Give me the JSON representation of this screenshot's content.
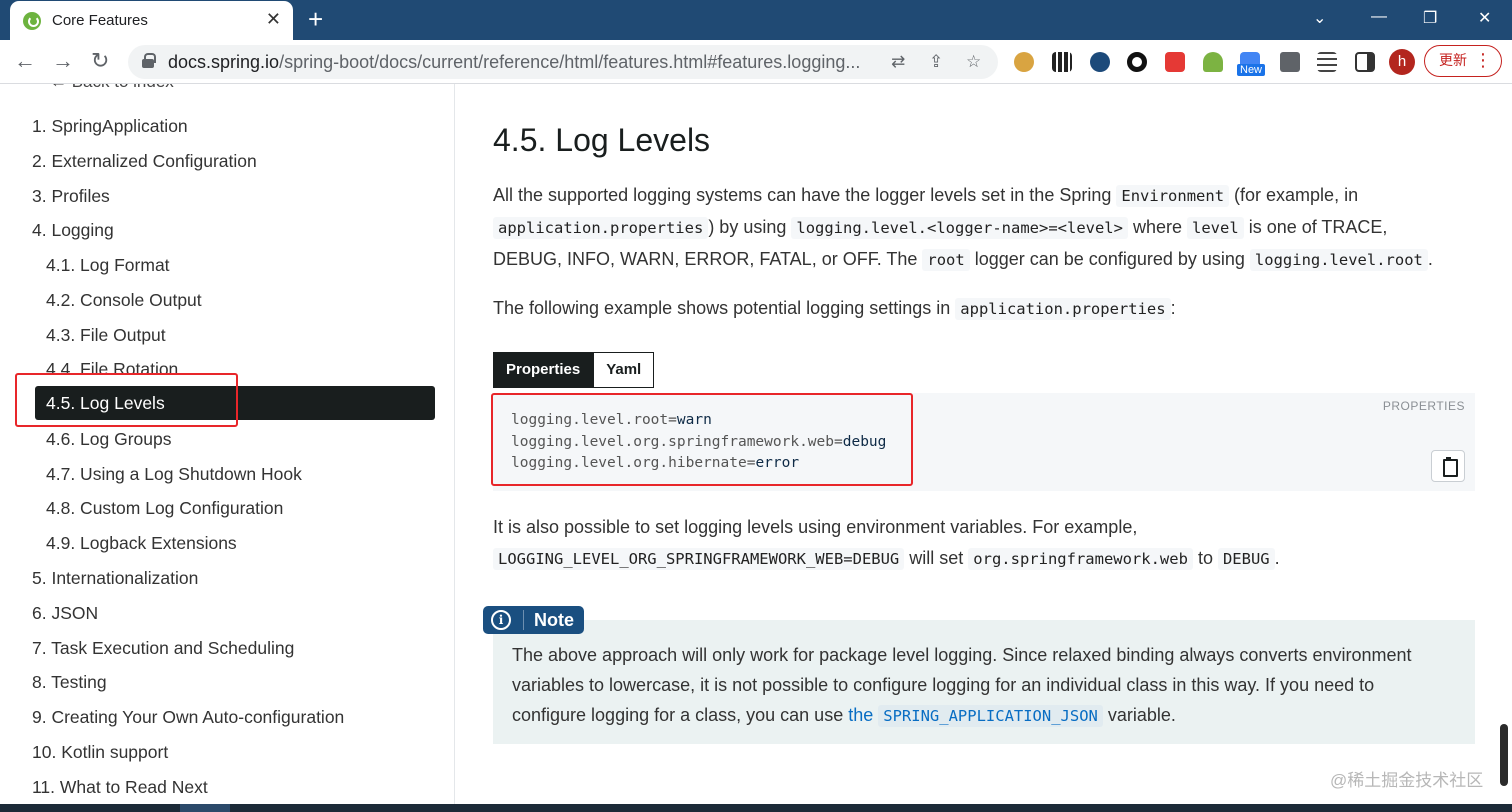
{
  "browser": {
    "tab_title": "Core Features",
    "tab_close": "✕",
    "new_tab": "+",
    "url_host": "docs.spring.io",
    "url_path": "/spring-boot/docs/current/reference/html/features.html#features.logging...",
    "new_badge": "New",
    "avatar_letter": "h",
    "update_label": "更新"
  },
  "sidebar": {
    "back_label": "← Back to index",
    "items": [
      {
        "label": "1. SpringApplication"
      },
      {
        "label": "2. Externalized Configuration"
      },
      {
        "label": "3. Profiles"
      },
      {
        "label": "4. Logging"
      },
      {
        "label": "4.1. Log Format"
      },
      {
        "label": "4.2. Console Output"
      },
      {
        "label": "4.3. File Output"
      },
      {
        "label": "4.4. File Rotation"
      },
      {
        "label": "4.5. Log Levels"
      },
      {
        "label": "4.6. Log Groups"
      },
      {
        "label": "4.7. Using a Log Shutdown Hook"
      },
      {
        "label": "4.8. Custom Log Configuration"
      },
      {
        "label": "4.9. Logback Extensions"
      },
      {
        "label": "5. Internationalization"
      },
      {
        "label": "6. JSON"
      },
      {
        "label": "7. Task Execution and Scheduling"
      },
      {
        "label": "8. Testing"
      },
      {
        "label": "9. Creating Your Own Auto-configuration"
      },
      {
        "label": "10. Kotlin support"
      },
      {
        "label": "11. What to Read Next"
      }
    ]
  },
  "main": {
    "heading": "4.5. Log Levels",
    "p1": {
      "t1": "All the supported logging systems can have the logger levels set in the Spring ",
      "c1": "Environment",
      "t2": " (for example, in",
      "c2": "application.properties",
      "t3": ") by using ",
      "c3": "logging.level.<logger-name>=<level>",
      "t4": " where ",
      "c4": "level",
      "t5": " is one of TRACE,",
      "t6": "DEBUG, INFO, WARN, ERROR, FATAL, or OFF. The ",
      "c5": "root",
      "t7": " logger can be configured by using ",
      "c6": "logging.level.root",
      "t8": "."
    },
    "p2": {
      "t1": "The following example shows potential logging settings in ",
      "c1": "application.properties",
      "t2": ":"
    },
    "code_tabs": [
      "Properties",
      "Yaml"
    ],
    "code_lang": "PROPERTIES",
    "code_lines": [
      {
        "key": "logging.level.root=",
        "val": "warn"
      },
      {
        "key": "logging.level.org.springframework.web=",
        "val": "debug"
      },
      {
        "key": "logging.level.org.hibernate=",
        "val": "error"
      }
    ],
    "p3": {
      "t1": "It is also possible to set logging levels using environment variables. For example,",
      "c1": "LOGGING_LEVEL_ORG_SPRINGFRAMEWORK_WEB=DEBUG",
      "t2": " will set ",
      "c2": "org.springframework.web",
      "t3": " to ",
      "c3": "DEBUG",
      "t4": "."
    },
    "note": {
      "label": "Note",
      "icon": "i",
      "t1": "The above approach will only work for package level logging. Since relaxed binding always converts environment",
      "t2": "variables to lowercase, it is not possible to configure logging for an individual class in this way. If you need to",
      "t3": "configure logging for a class, you can use ",
      "link_the": "the",
      "link_code": "SPRING_APPLICATION_JSON",
      "t4": " variable."
    }
  },
  "watermark": "@稀土掘金技术社区",
  "colors": {
    "browser_frame": "#204a74",
    "sidebar_active": "#191e1e",
    "highlight_box": "#e8262a",
    "note_label": "#1a4f80",
    "link": "#086dc3"
  }
}
